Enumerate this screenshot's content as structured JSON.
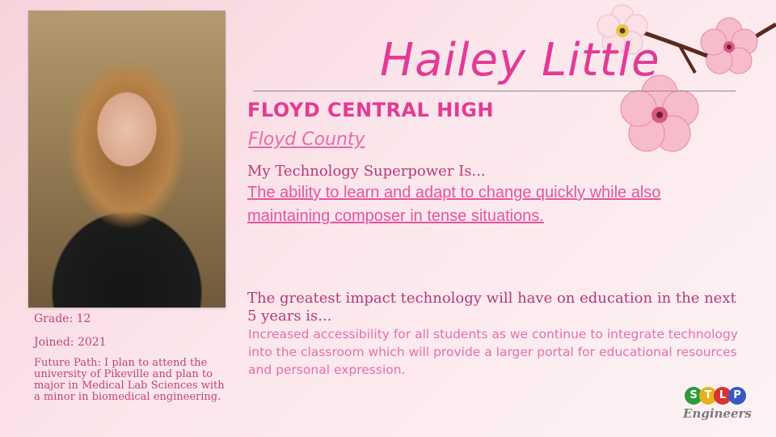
{
  "profile": {
    "name": "Hailey Little",
    "school": "Floyd Central High",
    "county": "Floyd County",
    "grade": "Grade: 12",
    "joined": "Joined: 2021",
    "future_path": "Future Path: I plan to attend the university of Pikeville and plan to major in Medical Lab Sciences with a minor in biomedical engineering."
  },
  "superpower": {
    "heading": "My Technology Superpower Is...",
    "answer": "The ability to learn and adapt to change quickly while also maintaining composer in tense situations."
  },
  "impact": {
    "heading": "The greatest impact technology will have on education in the next 5 years is...",
    "answer": "Increased accessibility for all students as we continue to integrate technology into the classroom which will provide a larger portal for educational resources and personal expression."
  },
  "logo": {
    "letters": [
      "S",
      "T",
      "L",
      "P"
    ],
    "colors": [
      "#2f9a3a",
      "#e5b11d",
      "#d8332f",
      "#3a57c4"
    ],
    "subtitle": "Engineers"
  },
  "colors": {
    "accent": "#e63a92",
    "heading": "#b53a79",
    "answer": "#e754a0"
  }
}
